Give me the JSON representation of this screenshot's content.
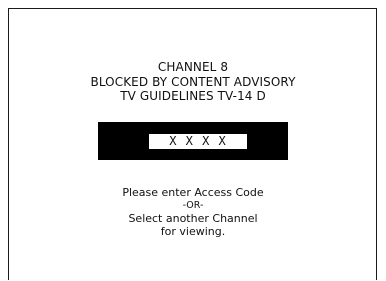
{
  "advisory": {
    "channel_line": "CHANNEL 8",
    "blocked_line": "BLOCKED BY CONTENT ADVISORY",
    "rating_line": "TV GUIDELINES TV-14 D"
  },
  "code_entry": {
    "value": "X X X X"
  },
  "instructions": {
    "line1": "Please enter Access Code",
    "line2": "-OR-",
    "line3": "Select another Channel",
    "line4": "for viewing."
  },
  "colors": {
    "background": "#ffffff",
    "bar": "#000000",
    "text": "#111111"
  }
}
